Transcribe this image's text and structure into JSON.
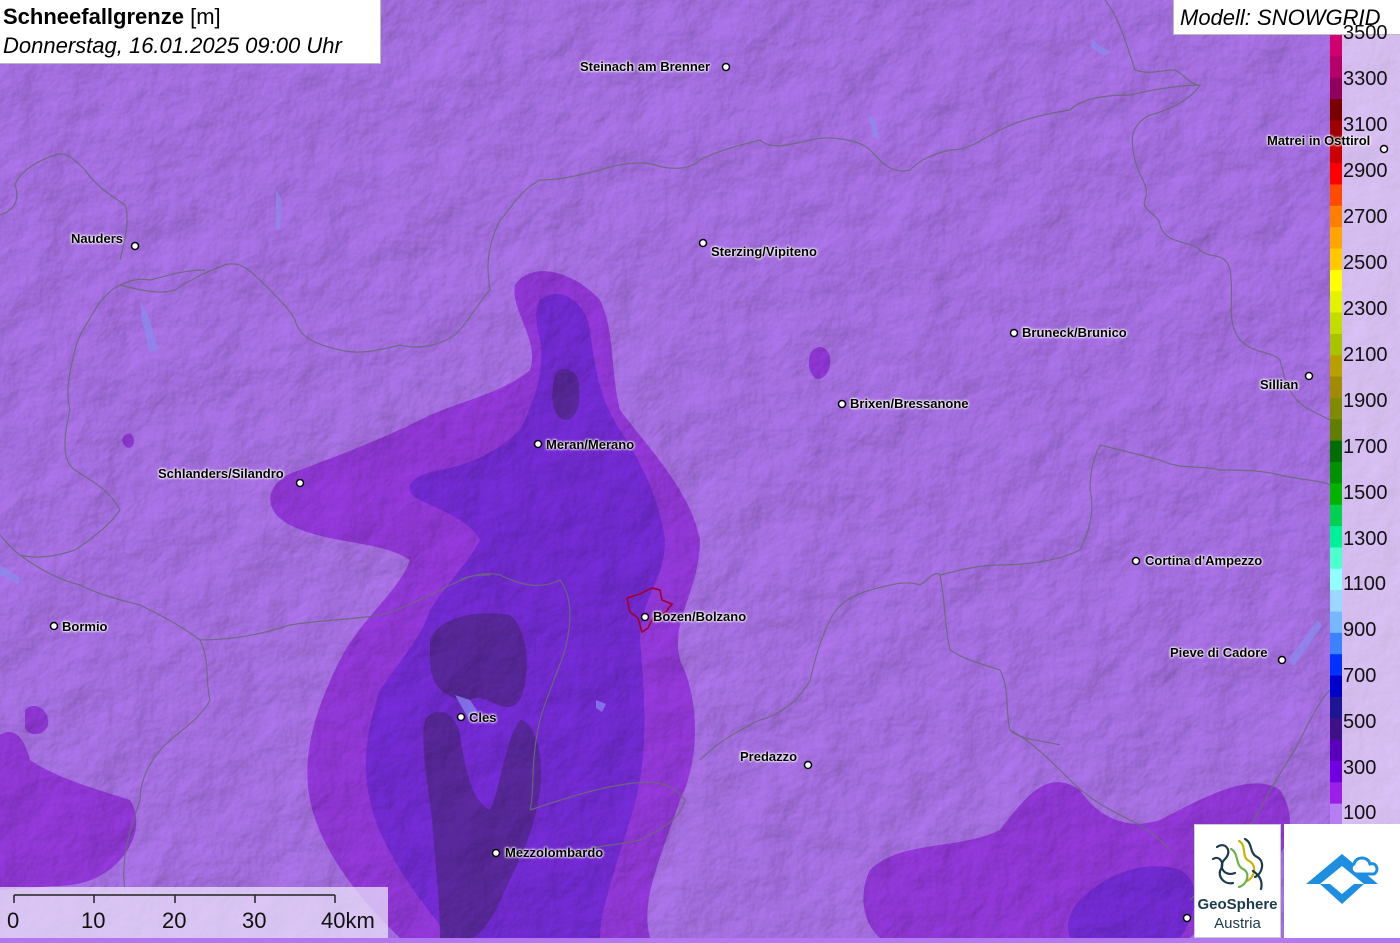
{
  "header": {
    "title_bold": "Schneefallgrenze",
    "title_unit": "[m]",
    "datetime": "Donnerstag, 16.01.2025 09:00 Uhr"
  },
  "model": {
    "label": "Modell: SNOWGRID"
  },
  "legend": {
    "labels": [
      "3500",
      "3300",
      "3100",
      "2900",
      "2700",
      "2500",
      "2300",
      "2100",
      "1900",
      "1700",
      "1500",
      "1300",
      "1100",
      "900",
      "700",
      "500",
      "300",
      "100"
    ],
    "colors": [
      "#d0006f",
      "#b5006a",
      "#92005e",
      "#7a0000",
      "#a00000",
      "#cc0000",
      "#ff0000",
      "#ff4b00",
      "#ff7f00",
      "#ffa500",
      "#ffc800",
      "#ffff00",
      "#e2f200",
      "#c2dd00",
      "#a8c400",
      "#b8a000",
      "#a08c00",
      "#808c00",
      "#5e7f00",
      "#006e00",
      "#009200",
      "#00b400",
      "#00d250",
      "#00f096",
      "#4cffcc",
      "#8fffff",
      "#9ad8ff",
      "#74b8ff",
      "#3b82ff",
      "#0033ff",
      "#0000cc",
      "#1c1694",
      "#3e1186",
      "#5a00bd",
      "#7000e0",
      "#9a20e8",
      "#b77ef2"
    ]
  },
  "cities": [
    {
      "name": "Steinach am Brenner"
    },
    {
      "name": "Matrei in Osttirol"
    },
    {
      "name": "Nauders"
    },
    {
      "name": "Sterzing/Vipiteno"
    },
    {
      "name": "Bruneck/Brunico"
    },
    {
      "name": "Sillian"
    },
    {
      "name": "Brixen/Bressanone"
    },
    {
      "name": "Meran/Merano"
    },
    {
      "name": "Schlanders/Silandro"
    },
    {
      "name": "Cortina d'Ampezzo"
    },
    {
      "name": "Bormio"
    },
    {
      "name": "Bozen/Bolzano"
    },
    {
      "name": "Pieve di Cadore"
    },
    {
      "name": "Cles"
    },
    {
      "name": "Predazzo"
    },
    {
      "name": "Mezzolombardo"
    }
  ],
  "scale": {
    "ticks": [
      "0",
      "10",
      "20",
      "30",
      "40km"
    ]
  },
  "logos": {
    "geosphere_name": "GeoSphere",
    "geosphere_sub": "Austria"
  },
  "colors": {
    "base": "#b278f2",
    "band_300": "#9b3ce6",
    "band_500": "#7a2ee0",
    "band_darkest": "#5a2a9a",
    "border": "#6a6a7a"
  }
}
